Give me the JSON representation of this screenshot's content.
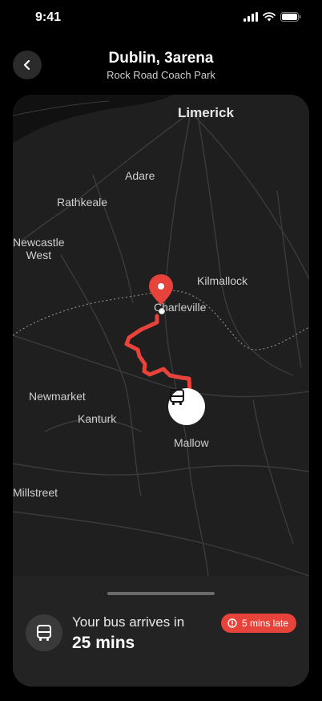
{
  "status_bar": {
    "time": "9:41",
    "icons": [
      "signal-icon",
      "wifi-icon",
      "battery-icon"
    ]
  },
  "header": {
    "title": "Dublin, 3arena",
    "subtitle": "Rock Road Coach Park",
    "back_icon": "chevron-left-icon"
  },
  "map": {
    "places": {
      "limerick": "Limerick",
      "adare": "Adare",
      "rathkeale": "Rathkeale",
      "newcastle_west": "Newcastle\nWest",
      "kilmallock": "Kilmallock",
      "charleville": "Charleville",
      "newmarket": "Newmarket",
      "kanturk": "Kanturk",
      "mallow": "Mallow",
      "millstreet": "Millstreet"
    },
    "route_color": "#e8433a",
    "destination_icon": "map-pin-icon",
    "vehicle_icon": "bus-icon"
  },
  "sheet": {
    "arrives_label": "Your bus arrives in",
    "eta": "25 mins",
    "late_badge": "5 mins late",
    "late_icon": "alert-circle-icon",
    "bus_icon": "bus-icon"
  }
}
